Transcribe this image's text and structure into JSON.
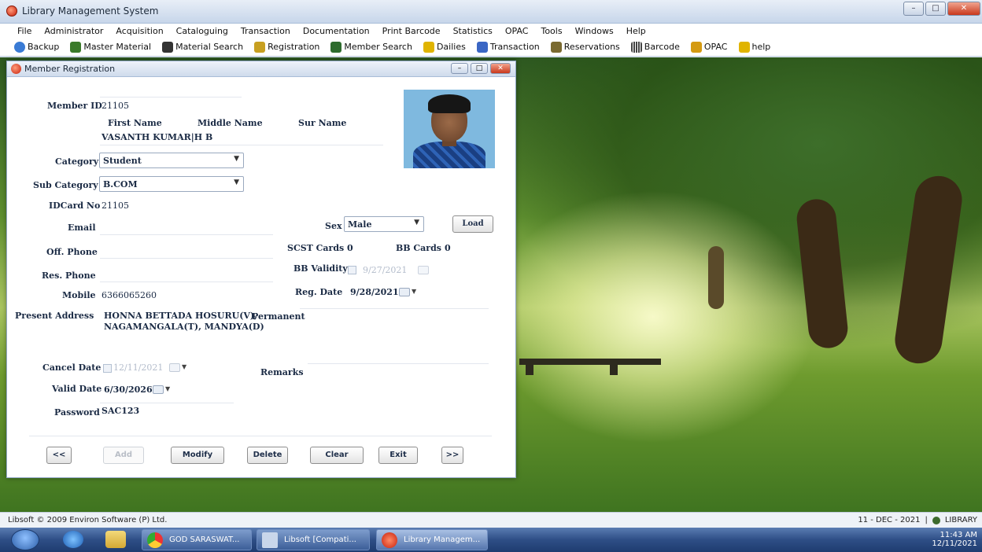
{
  "app": {
    "title": "Library Management System"
  },
  "menu": [
    "File",
    "Administrator",
    "Acquisition",
    "Cataloguing",
    "Transaction",
    "Documentation",
    "Print Barcode",
    "Statistics",
    "OPAC",
    "Tools",
    "Windows",
    "Help"
  ],
  "toolbar": [
    {
      "label": "Backup",
      "icon": "backup-icon",
      "color": "#3a7bd5"
    },
    {
      "label": "Master Material",
      "icon": "people-icon",
      "color": "#3a7a2a"
    },
    {
      "label": "Material Search",
      "icon": "binoculars-icon",
      "color": "#333333"
    },
    {
      "label": "Registration",
      "icon": "registration-icon",
      "color": "#c8a021"
    },
    {
      "label": "Member Search",
      "icon": "members-icon",
      "color": "#2d6b2d"
    },
    {
      "label": "Dailies",
      "icon": "dailies-icon",
      "color": "#e0b400"
    },
    {
      "label": "Transaction",
      "icon": "transaction-icon",
      "color": "#3a66c4"
    },
    {
      "label": "Reservations",
      "icon": "reservations-icon",
      "color": "#7a6a30"
    },
    {
      "label": "Barcode",
      "icon": "barcode-icon",
      "color": "#444444"
    },
    {
      "label": "OPAC",
      "icon": "opac-icon",
      "color": "#d49a12"
    },
    {
      "label": "help",
      "icon": "help-icon",
      "color": "#e0b400"
    }
  ],
  "window": {
    "title": "Member Registration",
    "form": {
      "member_id_label": "Member ID",
      "member_id": "21105",
      "first_name_label": "First Name",
      "middle_name_label": "Middle Name",
      "sur_name_label": "Sur Name",
      "name_value": "VASANTH KUMAR|H B",
      "category_label": "Category",
      "category": "Student",
      "sub_category_label": "Sub Category",
      "sub_category": "B.COM",
      "idcard_label": "IDCard No",
      "idcard": "21105",
      "email_label": "Email",
      "sex_label": "Sex",
      "sex": "Male",
      "load_label": "Load",
      "off_phone_label": "Off. Phone",
      "scst_label": "SCST Cards",
      "scst_value": "0",
      "bb_cards_label": "BB Cards",
      "bb_cards_value": "0",
      "res_phone_label": "Res. Phone",
      "bb_validity_label": "BB Validity",
      "bb_validity": "9/27/2021",
      "mobile_label": "Mobile",
      "mobile": "6366065260",
      "reg_date_label": "Reg. Date",
      "reg_date": "9/28/2021",
      "present_address_label": "Present Address",
      "present_address_1": "HONNA BETTADA HOSURU(V),",
      "present_address_2": "NAGAMANGALA(T), MANDYA(D)",
      "permanent_label": "Permanent",
      "cancel_date_label": "Cancel Date",
      "cancel_date": "12/11/2021",
      "remarks_label": "Remarks",
      "valid_date_label": "Valid Date",
      "valid_date": "6/30/2026",
      "password_label": "Password",
      "password": "SAC123"
    },
    "buttons": {
      "prev": "<<",
      "add": "Add",
      "modify": "Modify",
      "delete": "Delete",
      "clear": "Clear",
      "exit": "Exit",
      "next": ">>"
    }
  },
  "status": {
    "left": "Libsoft © 2009  Environ Software (P) Ltd.",
    "date": "11 - DEC - 2021",
    "user": "LIBRARY"
  },
  "taskbar": {
    "tasks": [
      "GOD SARASWAT...",
      "Libsoft [Compati...",
      "Library Managem..."
    ],
    "time": "11:43 AM",
    "date": "12/11/2021"
  }
}
